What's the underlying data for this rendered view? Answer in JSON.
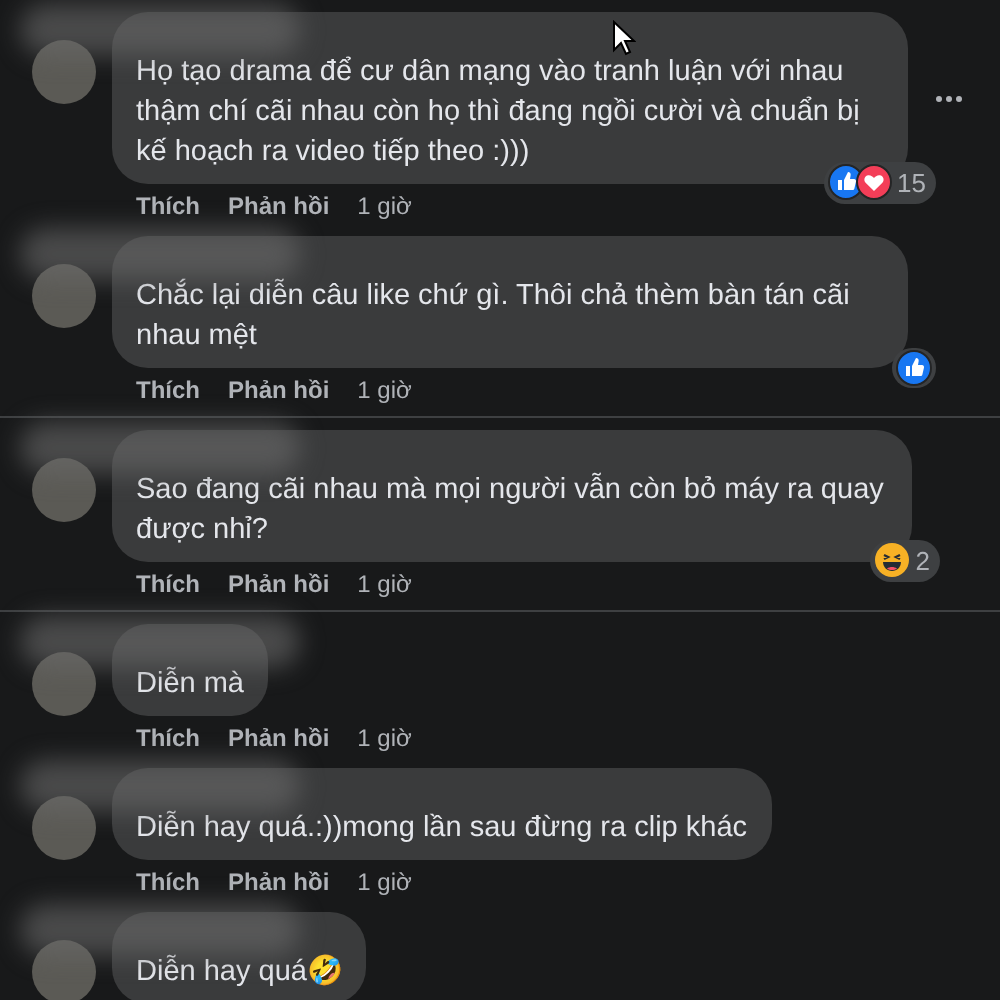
{
  "comments": [
    {
      "text": "Họ tạo drama để cư dân mạng vào tranh luận với nhau thậm chí cãi nhau còn họ thì đang ngồi cười và chuẩn bị kế hoạch ra video tiếp theo :)))",
      "more_menu": true,
      "reactions": [
        {
          "kind": "like"
        },
        {
          "kind": "love"
        }
      ],
      "reaction_count": "15",
      "actions": [
        "Thích",
        "Phản hồi",
        "1 giờ"
      ],
      "divider_after": false
    },
    {
      "text": "Chắc lại diễn câu like chứ gì. Thôi chả thèm bàn tán cãi nhau mệt",
      "more_menu": false,
      "reactions": [
        {
          "kind": "like"
        }
      ],
      "actions": [
        "Thích",
        "Phản hồi",
        "1 giờ"
      ],
      "divider_after": true
    },
    {
      "text": "Sao đang cãi nhau mà mọi người vẫn còn bỏ máy ra quay được nhỉ?",
      "more_menu": false,
      "reactions": [
        {
          "kind": "haha"
        }
      ],
      "reaction_count": "2",
      "actions": [
        "Thích",
        "Phản hồi",
        "1 giờ"
      ],
      "divider_after": true
    },
    {
      "text": "Diễn mà",
      "more_menu": false,
      "actions": [
        "Thích",
        "Phản hồi",
        "1 giờ"
      ],
      "divider_after": false
    },
    {
      "text": "Diễn hay quá.:))mong lần sau đừng ra clip khác",
      "more_menu": false,
      "actions": [
        "Thích",
        "Phản hồi",
        "1 giờ"
      ],
      "divider_after": false
    },
    {
      "text": "Diễn hay quá🤣",
      "more_menu": false,
      "divider_after": false
    }
  ]
}
